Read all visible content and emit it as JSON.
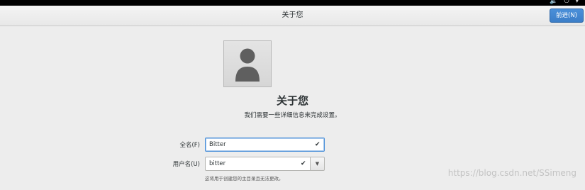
{
  "system": {
    "indicators": "🔈 ⏻ ▾"
  },
  "header": {
    "title": "关于您",
    "next_label": "前进(N)"
  },
  "main": {
    "title": "关于您",
    "subtitle": "我们需要一些详细信息来完成设置。",
    "full_name": {
      "label": "全名(F)",
      "value": "Bitter"
    },
    "username": {
      "label": "用户名(U)",
      "value": "bitter"
    },
    "hint": "这将用于创建您的主目录且无法更改。"
  },
  "watermark": "https://blog.csdn.net/SSimeng"
}
